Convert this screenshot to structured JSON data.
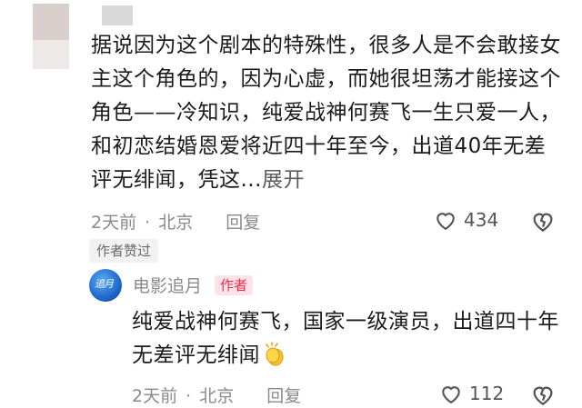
{
  "comment": {
    "text": "据说因为这个剧本的特殊性，很多人是不会敢接女主这个角色的，因为心虚，而她很坦荡才能接这个角色——冷知识，纯爱战神何赛飞一生只爱一人，和初恋结婚恩爱将近四十年至今，出道40年无差评无绯闻，凭这...",
    "expand_label": "展开",
    "time": "2天前",
    "location": "北京",
    "reply_label": "回复",
    "like_count": "434",
    "author_liked_label": "作者赞过"
  },
  "reply": {
    "username": "电影追月",
    "avatar_text": "追月",
    "author_badge": "作者",
    "text": "纯爱战神何赛飞，国家一级演员，出道四十年无差评无绯闻",
    "emoji": "clap-emoji",
    "time": "2天前",
    "location": "北京",
    "reply_label": "回复",
    "like_count": "112"
  },
  "colors": {
    "meta_gray": "#8a8a8a",
    "badge_red": "#f2294a",
    "badge_bg": "#fbe3e6"
  }
}
